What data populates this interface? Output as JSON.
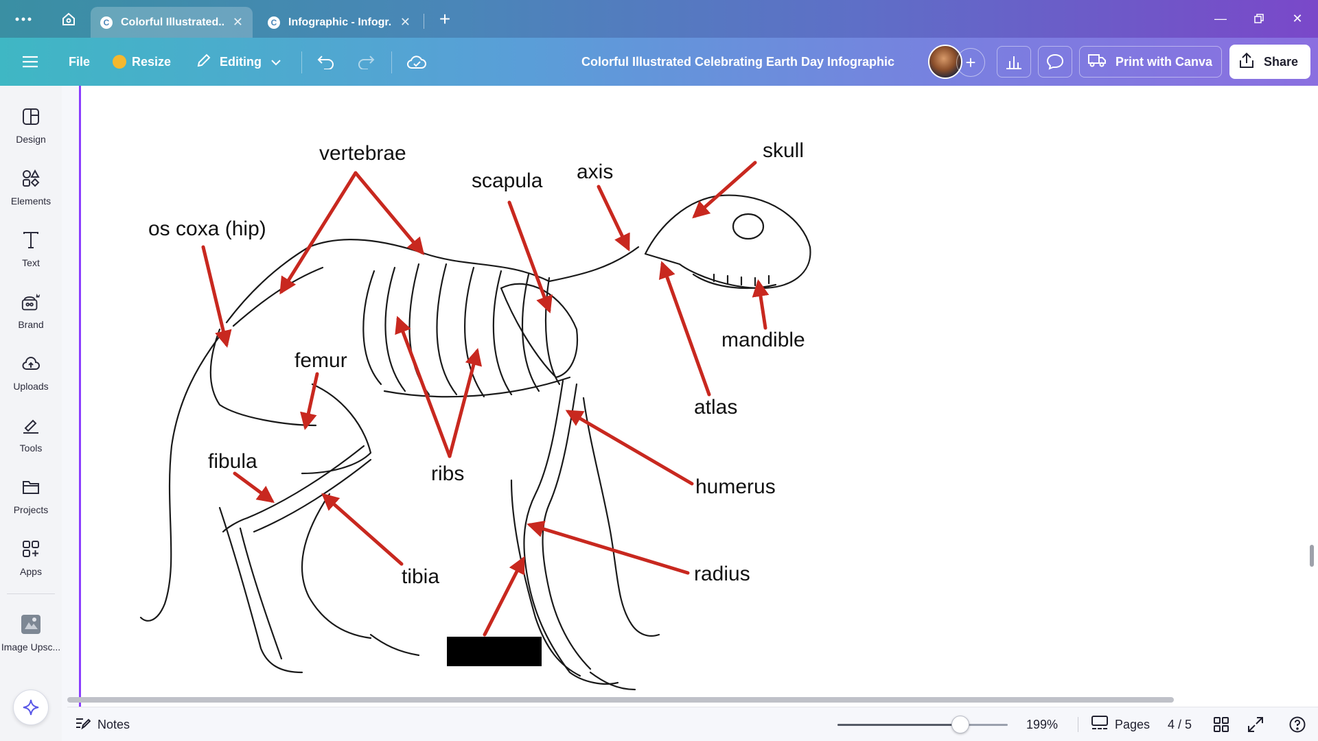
{
  "browser": {
    "tabs": [
      {
        "title": "Colorful Illustrated...",
        "active": true
      },
      {
        "title": "Infographic - Infogr...",
        "active": false
      }
    ]
  },
  "toolbar": {
    "file": "File",
    "resize": "Resize",
    "editing": "Editing",
    "doc_title": "Colorful Illustrated Celebrating Earth Day Infographic",
    "print": "Print with Canva",
    "share": "Share"
  },
  "sidebar": {
    "items": [
      {
        "label": "Design",
        "icon": "design-icon"
      },
      {
        "label": "Elements",
        "icon": "elements-icon"
      },
      {
        "label": "Text",
        "icon": "text-icon"
      },
      {
        "label": "Brand",
        "icon": "brand-icon"
      },
      {
        "label": "Uploads",
        "icon": "uploads-icon"
      },
      {
        "label": "Tools",
        "icon": "tools-icon"
      },
      {
        "label": "Projects",
        "icon": "projects-icon"
      },
      {
        "label": "Apps",
        "icon": "apps-icon"
      },
      {
        "label": "Image Upsc...",
        "icon": "image-upscaler-icon"
      }
    ]
  },
  "diagram": {
    "labels": {
      "vertebrae": "vertebrae",
      "skull": "skull",
      "scapula": "scapula",
      "axis": "axis",
      "os_coxa": "os coxa (hip)",
      "mandible": "mandible",
      "femur": "femur",
      "atlas": "atlas",
      "fibula": "fibula",
      "ribs": "ribs",
      "humerus": "humerus",
      "tibia": "tibia",
      "radius": "radius"
    },
    "arrow_color": "#c8281f"
  },
  "footer": {
    "notes": "Notes",
    "zoom": "199%",
    "zoom_slider_fraction": 0.72,
    "pages": "Pages",
    "page_indicator": "4 / 5"
  },
  "colors": {
    "accent": "#8b3dff",
    "toolbar_start": "#3fb7c4",
    "toolbar_end": "#8a6fe0"
  }
}
